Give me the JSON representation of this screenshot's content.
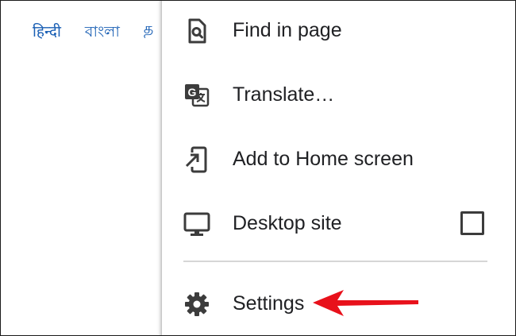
{
  "background_page": {
    "languages": [
      "हिन्दी",
      "বাংলা",
      "த"
    ]
  },
  "menu": {
    "items": [
      {
        "label": "Find in page",
        "icon": "find-in-page-icon"
      },
      {
        "label": "Translate…",
        "icon": "translate-icon"
      },
      {
        "label": "Add to Home screen",
        "icon": "add-to-home-screen-icon"
      },
      {
        "label": "Desktop site",
        "icon": "desktop-icon",
        "checkbox_checked": false
      },
      {
        "label": "Settings",
        "icon": "gear-icon"
      }
    ]
  },
  "annotation": {
    "arrow_color": "#e8111b",
    "points_to": "Settings"
  }
}
